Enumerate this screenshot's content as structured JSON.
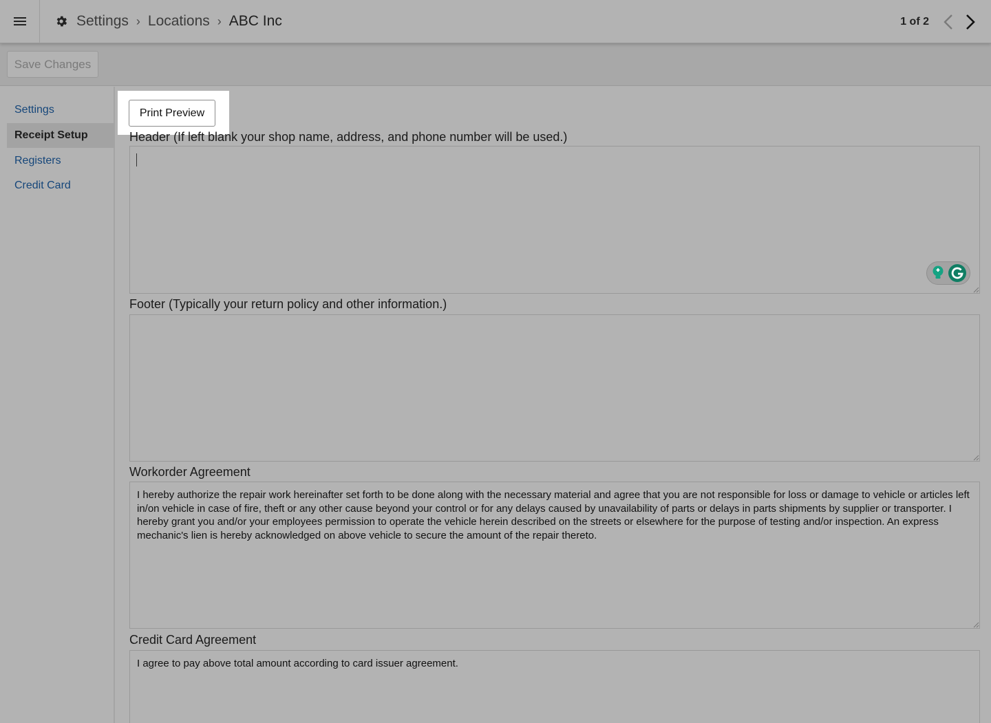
{
  "topbar": {
    "menu_icon": "hamburger-menu-icon",
    "settings_icon": "gear-icon",
    "breadcrumbs": [
      "Settings",
      "Locations",
      "ABC Inc"
    ],
    "pager_text": "1 of 2",
    "prev_icon": "chevron-left-icon",
    "next_icon": "chevron-right-icon"
  },
  "toolbar": {
    "save_label": "Save Changes"
  },
  "sidebar": {
    "items": [
      {
        "label": "Settings",
        "active": false
      },
      {
        "label": "Receipt Setup",
        "active": true
      },
      {
        "label": "Registers",
        "active": false
      },
      {
        "label": "Credit Card",
        "active": false
      }
    ]
  },
  "main": {
    "print_preview_label": "Print Preview",
    "header": {
      "label": "Header (If left blank your shop name, address, and phone number will be used.)",
      "value": ""
    },
    "footer": {
      "label": "Footer (Typically your return policy and other information.)",
      "value": ""
    },
    "workorder": {
      "label": "Workorder Agreement",
      "value": "I hereby authorize the repair work hereinafter set forth to be done along with the necessary material and agree that you are not responsible for loss or damage to vehicle or articles left in/on vehicle in case of fire, theft or any other cause beyond your control or for any delays caused by unavailability of parts or delays in parts shipments by supplier or transporter. I hereby grant you and/or your employees permission to operate the vehicle herein described on the streets or elsewhere for the purpose of testing and/or inspection. An express mechanic's lien is hereby acknowledged on above vehicle to secure the amount of the repair thereto."
    },
    "credit_card": {
      "label": "Credit Card Agreement",
      "value": "I agree to pay above total amount according to card issuer agreement."
    },
    "grammarly_icons": [
      "lightbulb-icon",
      "grammarly-g-icon"
    ]
  },
  "colors": {
    "background": "#b3b3b3",
    "link": "#15467a",
    "highlight": "#ffffff",
    "grammarly": "#15c39a"
  }
}
